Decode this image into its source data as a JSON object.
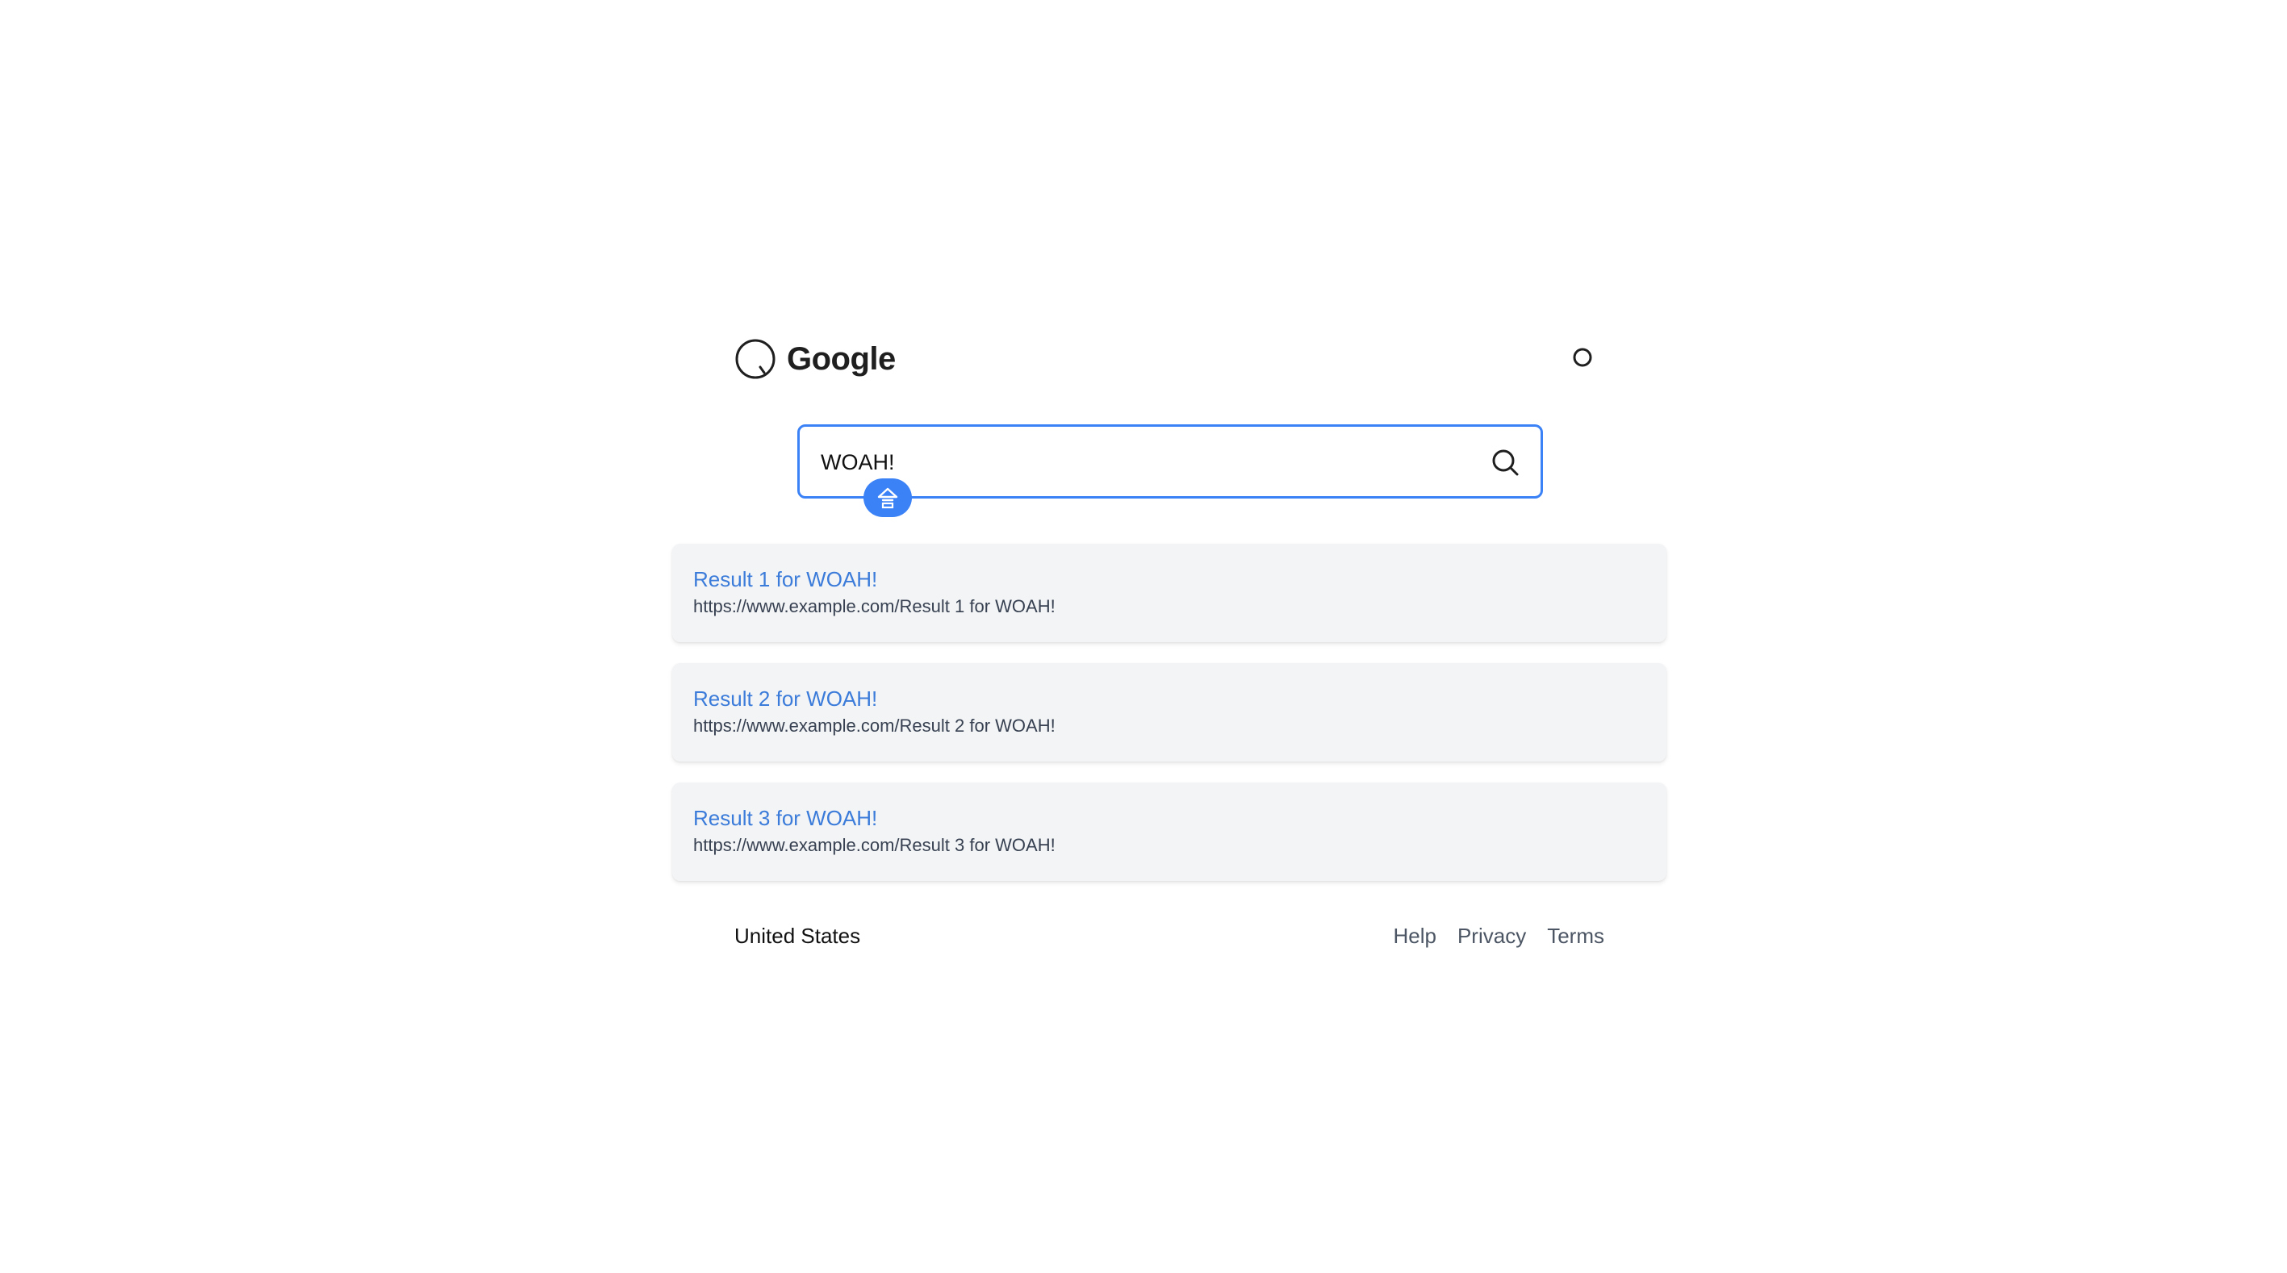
{
  "header": {
    "logo_text": "Google",
    "logo_icon": "search-circle-icon",
    "profile_icon": "profile-circle-icon"
  },
  "search": {
    "value": "WOAH!",
    "icon": "search-icon",
    "badge_icon": "home-icon"
  },
  "results": [
    {
      "title": "Result 1 for WOAH!",
      "url": "https://www.example.com/Result 1 for WOAH!"
    },
    {
      "title": "Result 2 for WOAH!",
      "url": "https://www.example.com/Result 2 for WOAH!"
    },
    {
      "title": "Result 3 for WOAH!",
      "url": "https://www.example.com/Result 3 for WOAH!"
    }
  ],
  "footer": {
    "region": "United States",
    "links": [
      "Help",
      "Privacy",
      "Terms"
    ]
  },
  "colors": {
    "accent": "#3b82f6",
    "result_title": "#3b7bd9",
    "result_background": "#f3f4f6",
    "text": "#111111",
    "muted_text": "#4b5563"
  }
}
